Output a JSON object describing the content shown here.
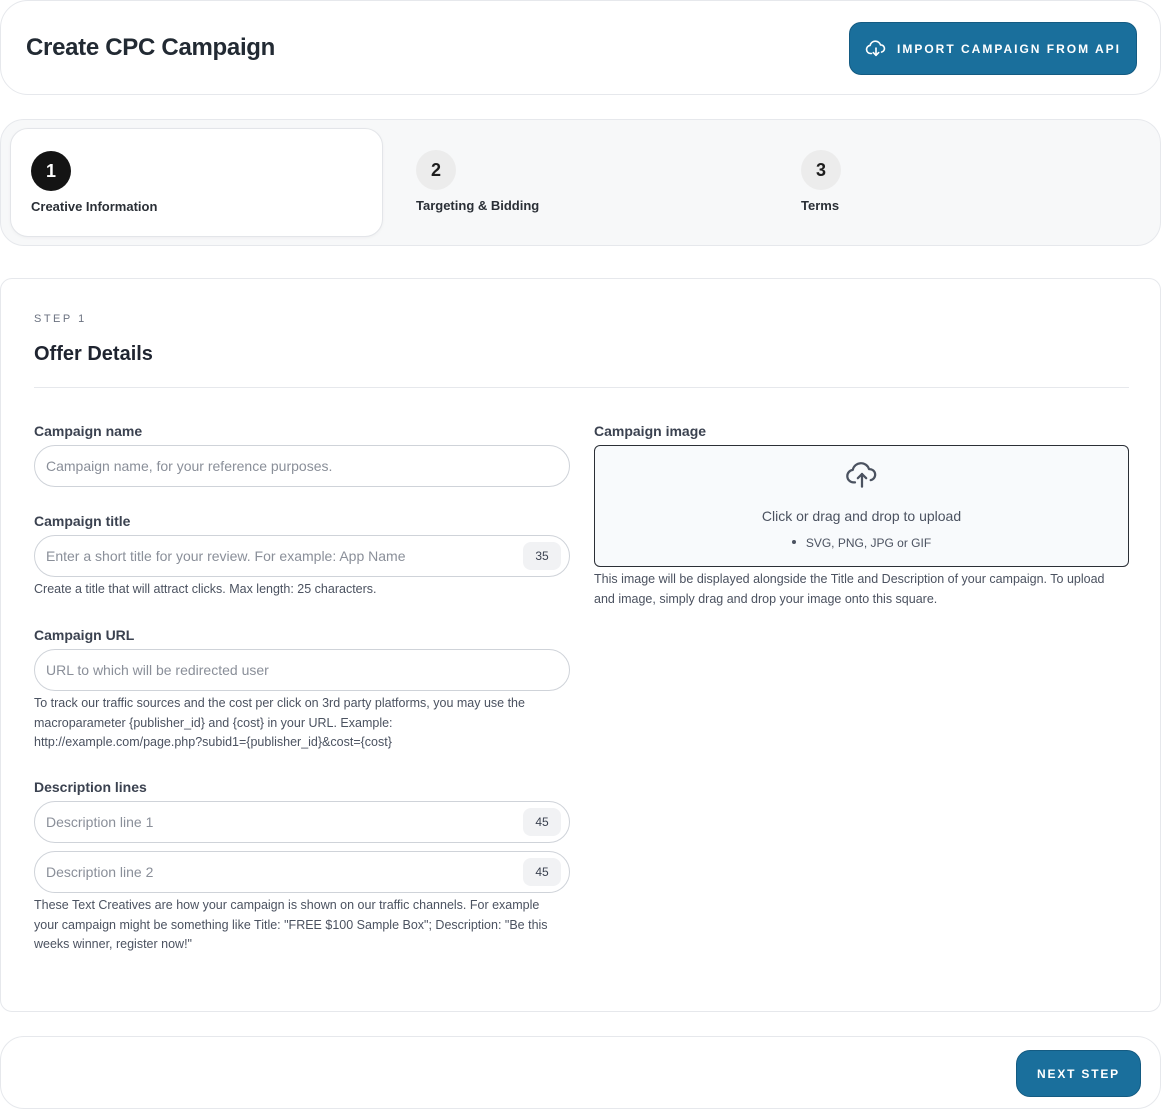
{
  "header": {
    "title": "Create CPC Campaign",
    "import_button": "IMPORT CAMPAIGN FROM API",
    "import_icon": "cloud-download-icon"
  },
  "stepper": {
    "active_step": 1,
    "steps": [
      {
        "number": "1",
        "label": "Creative Information"
      },
      {
        "number": "2",
        "label": "Targeting & Bidding"
      },
      {
        "number": "3",
        "label": "Terms"
      }
    ]
  },
  "form": {
    "kicker": "STEP 1",
    "title": "Offer Details",
    "campaign_name": {
      "label": "Campaign name",
      "placeholder": "Campaign name, for your reference purposes."
    },
    "campaign_title": {
      "label": "Campaign title",
      "placeholder": "Enter a short title for your review. For example: App Name",
      "counter": "35",
      "help": "Create a title that will attract clicks. Max length: 25 characters."
    },
    "campaign_url": {
      "label": "Campaign URL",
      "placeholder": "URL to which will be redirected user",
      "help_line1": "To track our traffic sources and the cost per click on 3rd party platforms, you may use the",
      "help_line2": "macroparameter {publisher_id} and {cost} in your URL. Example:",
      "help_line3": "http://example.com/page.php?subid1={publisher_id}&cost={cost}"
    },
    "description_lines": {
      "label": "Description lines",
      "line1_placeholder": "Description line 1",
      "line1_counter": "45",
      "line2_placeholder": "Description line 2",
      "line2_counter": "45",
      "help_line1": "These Text Creatives are how your campaign is shown on our traffic channels. For example",
      "help_line2": "your campaign might be something like Title: \"FREE $100 Sample Box\"; Description: \"Be this",
      "help_line3": "weeks winner, register now!\""
    },
    "campaign_image": {
      "label": "Campaign image",
      "upload_text": "Click or drag and drop to upload",
      "file_types": "SVG, PNG, JPG or GIF",
      "upload_icon": "cloud-upload-icon",
      "help_line1": "This image will be displayed alongside the Title and Description of your campaign. To upload",
      "help_line2": "and image, simply drag and drop your image onto this square."
    }
  },
  "footer": {
    "next_button": "NEXT STEP"
  },
  "colors": {
    "primary": "#1a6f9c",
    "active_step": "#141414"
  }
}
